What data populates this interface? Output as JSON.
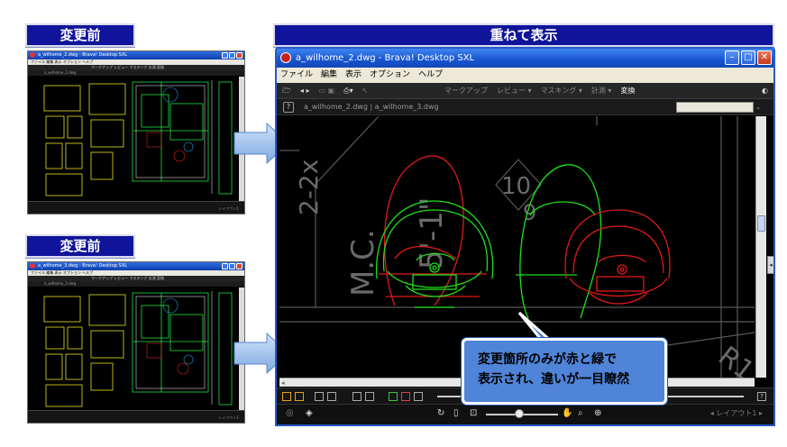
{
  "headers": {
    "before_top": "変更前",
    "before_bottom": "変更前",
    "overlay": "重ねて表示"
  },
  "thumb_top": {
    "title": "a_wilhome_2.dwg - Brava! Desktop SXL",
    "menu": "ファイル  編集  表示  オプション  ヘルプ",
    "toolbar": "マークアップ  レビュー  マスキング  計測  変換",
    "tab": "a_wilhome_2.dwg",
    "layout": "レイアウト1"
  },
  "thumb_bottom": {
    "title": "a_wilhome_3.dwg - Brava! Desktop SXL",
    "menu": "ファイル  編集  表示  オプション  ヘルプ",
    "toolbar": "マークアップ  レビュー  マスキング  計測  変換",
    "tab": "a_wilhome_3.dwg",
    "layout": "レイアウト1"
  },
  "window": {
    "title": "a_wilhome_2.dwg - Brava! Desktop SXL",
    "menu": [
      "ファイル",
      "編集",
      "表示",
      "オプション",
      "ヘルプ"
    ],
    "toolbar": [
      "マークアップ",
      "レビュー ▾",
      "マスキング ▾",
      "計測 ▾",
      "変換"
    ],
    "tabs_text": "a_wilhome_2.dwg | a_wilhome_3.dwg",
    "help": "?",
    "layout": "◂ レイアウト1 ▸",
    "drawing_labels": {
      "label_2x": "2-2x",
      "label_mc": "M.C.",
      "label_51": "5'-1\"",
      "label_10": "10",
      "label_9": "9",
      "label_r1": "R1"
    }
  },
  "callout": {
    "line1": "変更箇所のみが赤と緑で",
    "line2": "表示され、違いが一目瞭然"
  },
  "colors": {
    "header_bg": "#10149a",
    "arrow": "#a8c8f0",
    "changed_red": "#e01a1a",
    "changed_green": "#1ee01a",
    "callout_bg": "#4f84d8",
    "titlebar": "#1654d0"
  }
}
